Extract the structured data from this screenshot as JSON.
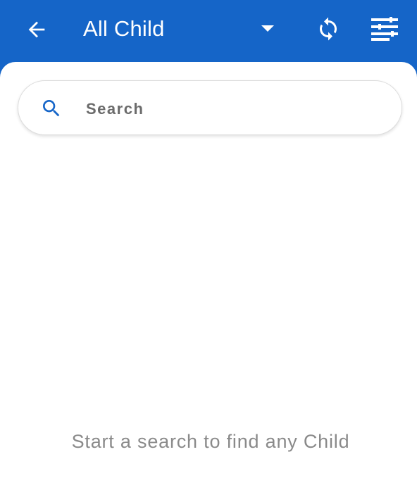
{
  "app_bar": {
    "title": "All Child",
    "back_icon": "arrow-left-icon",
    "dropdown_icon": "caret-down-icon",
    "sync_icon": "sync-icon",
    "filter_icon": "filter-list-icon",
    "background_color": "#1565c8"
  },
  "search": {
    "placeholder": "Search",
    "value": "",
    "icon": "search-icon",
    "icon_color": "#1565c8"
  },
  "empty_state": {
    "message": "Start a search to find any Child"
  }
}
